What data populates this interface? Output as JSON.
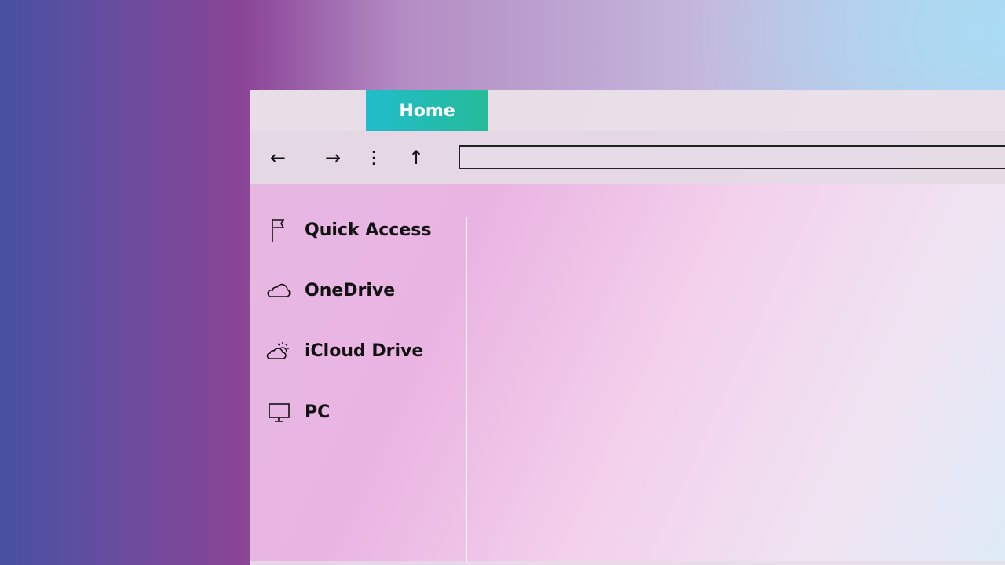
{
  "tabs": [
    {
      "label": "Home",
      "active": true,
      "color_start": "#22bccc",
      "color_end": "#24bc98"
    }
  ],
  "toolbar": {
    "back_icon": "arrow-left",
    "back_glyph": "←",
    "forward_icon": "arrow-right",
    "forward_glyph": "→",
    "more_icon": "vertical-ellipsis",
    "more_glyph": "⋮",
    "up_icon": "arrow-up",
    "up_glyph": "↑",
    "address_value": ""
  },
  "sidebar": {
    "items": [
      {
        "label": "Quick Access",
        "icon": "flag-icon"
      },
      {
        "label": "OneDrive",
        "icon": "cloud-icon"
      },
      {
        "label": "iCloud Drive",
        "icon": "cloud-sun-icon"
      },
      {
        "label": "PC",
        "icon": "monitor-icon"
      }
    ]
  }
}
